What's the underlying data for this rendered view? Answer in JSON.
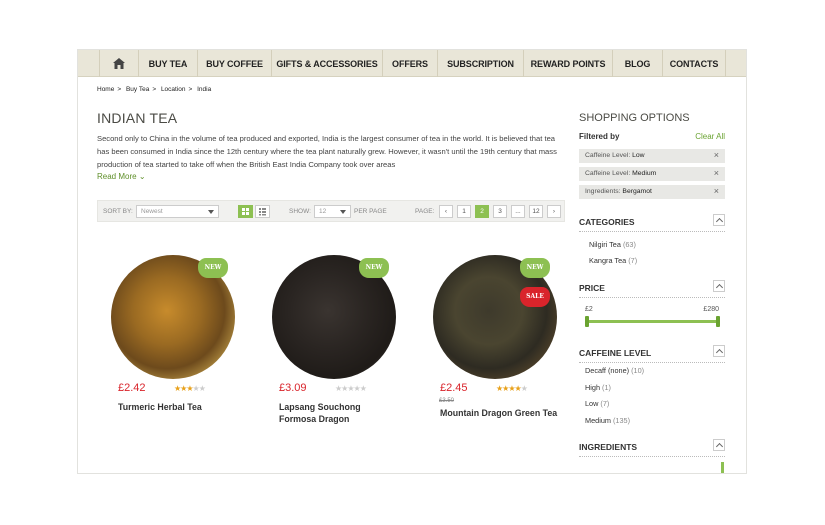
{
  "nav": {
    "home_icon": "home-icon",
    "items": [
      "BUY TEA",
      "BUY COFFEE",
      "GIFTS & ACCESSORIES",
      "OFFERS",
      "SUBSCRIPTION",
      "REWARD POINTS",
      "BLOG",
      "CONTACTS"
    ]
  },
  "breadcrumb": [
    "Home",
    "Buy Tea",
    "Location",
    "India"
  ],
  "page_title": "INDIAN TEA",
  "description": "Second only to China in the volume of tea produced and exported, India is the largest consumer of tea in the world. It is believed that tea has been consumed in India since the 12th century where the tea plant naturally grew. However, it wasn't until the 19th century that mass production of tea started to take off when the British East India Company took over areas",
  "read_more": "Read More",
  "toolbar": {
    "sort_label": "SORT BY:",
    "sort_value": "Newest",
    "show_label": "SHOW:",
    "show_value": "12",
    "per_page": "PER PAGE",
    "page_label": "PAGE:",
    "pages": [
      "1",
      "2",
      "3",
      "...",
      "12"
    ],
    "active_page": "2"
  },
  "products": [
    {
      "name": "Turmeric Herbal Tea",
      "price": "£2.42",
      "old_price": "",
      "rating": 3,
      "badges": [
        "NEW"
      ]
    },
    {
      "name": "Lapsang Souchong Formosa Dragon",
      "price": "£3.09",
      "old_price": "",
      "rating": 0,
      "badges": [
        "NEW"
      ]
    },
    {
      "name": "Mountain Dragon Green Tea",
      "price": "£2.45",
      "old_price": "£3.50",
      "rating": 4,
      "badges": [
        "NEW",
        "SALE"
      ]
    }
  ],
  "sidebar": {
    "title": "SHOPPING OPTIONS",
    "filtered_by": "Filtered by",
    "clear_all": "Clear All",
    "filters": [
      {
        "label": "Caffeine Level:",
        "value": "Low"
      },
      {
        "label": "Caffeine Level:",
        "value": "Medium"
      },
      {
        "label": "Ingredients:",
        "value": "Bergamot"
      }
    ],
    "categories_title": "CATEGORIES",
    "categories": [
      {
        "name": "Nilgiri Tea",
        "count": "(63)"
      },
      {
        "name": "Kangra Tea",
        "count": "(7)"
      }
    ],
    "price_title": "PRICE",
    "price_min": "£2",
    "price_max": "£280",
    "caffeine_title": "CAFFEINE LEVEL",
    "caffeine": [
      {
        "name": "Decaff (none)",
        "count": "(10)"
      },
      {
        "name": "High",
        "count": "(1)"
      },
      {
        "name": "Low",
        "count": "(7)"
      },
      {
        "name": "Medium",
        "count": "(135)"
      }
    ],
    "ingredients_title": "INGREDIENTS"
  },
  "colors": {
    "accent": "#8dc052",
    "price": "#d9242b",
    "nav_bg": "#e9e6d8"
  }
}
